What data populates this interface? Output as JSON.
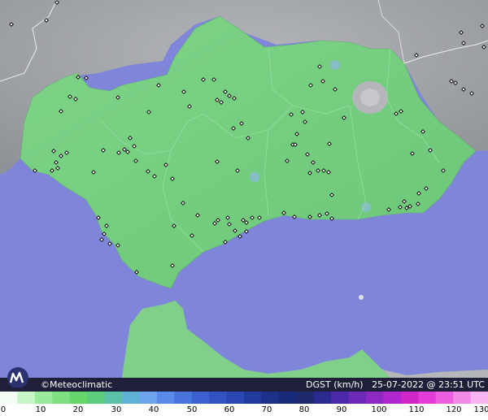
{
  "footer": {
    "brand": "©Meteoclimatic",
    "variable": "DGST (km/h)",
    "timestamp": "25-07-2022 @ 23:51 UTC"
  },
  "scale": {
    "ticks": [
      "0",
      "10",
      "20",
      "30",
      "40",
      "50",
      "60",
      "70",
      "80",
      "90",
      "100",
      "110",
      "120",
      "130"
    ]
  },
  "colors": {
    "sea": "#7f86d9",
    "land_gray": "#a6a8ab",
    "andalusia_green": "#76cf7f",
    "morocco_green": "#80d08a",
    "station": "#000000"
  },
  "icons": [
    "meteoclimatic-logo-icon",
    "station-marker-icon"
  ]
}
